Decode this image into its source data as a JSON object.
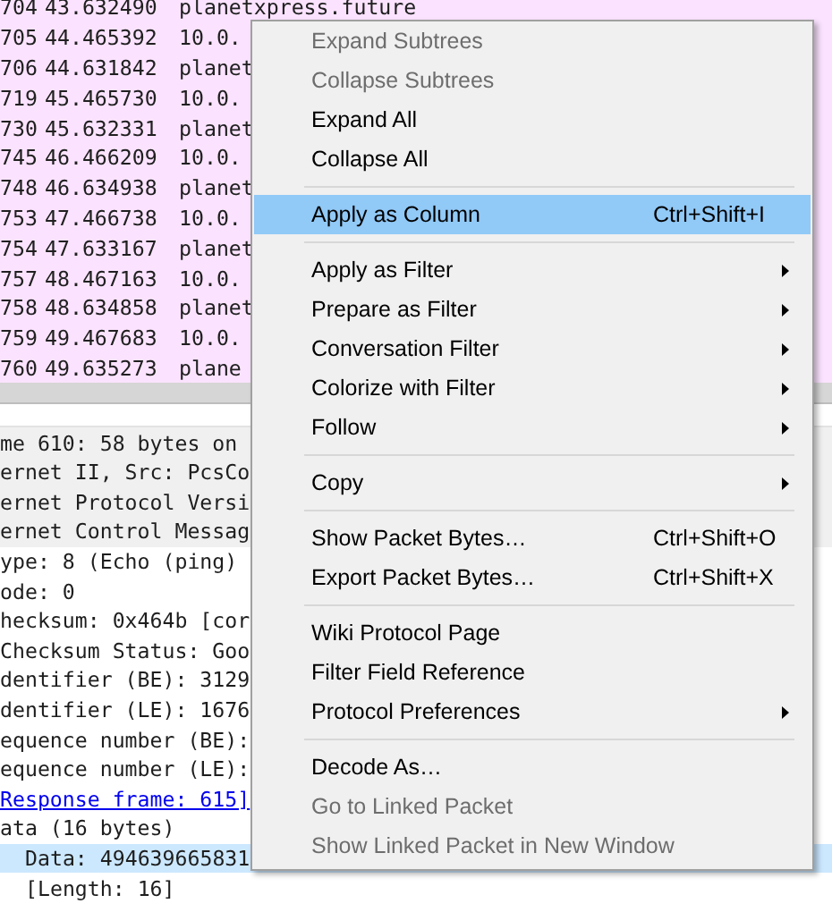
{
  "packet_list": {
    "rows": [
      {
        "number": "704",
        "time": "43.632490",
        "source": "planetxpress.future"
      },
      {
        "number": "705",
        "time": "44.465392",
        "source": "10.0."
      },
      {
        "number": "706",
        "time": "44.631842",
        "source": "planet"
      },
      {
        "number": "719",
        "time": "45.465730",
        "source": "10.0."
      },
      {
        "number": "730",
        "time": "45.632331",
        "source": "planet"
      },
      {
        "number": "745",
        "time": "46.466209",
        "source": "10.0."
      },
      {
        "number": "748",
        "time": "46.634938",
        "source": "planet"
      },
      {
        "number": "753",
        "time": "47.466738",
        "source": "10.0."
      },
      {
        "number": "754",
        "time": "47.633167",
        "source": "planet"
      },
      {
        "number": "757",
        "time": "48.467163",
        "source": "10.0."
      },
      {
        "number": "758",
        "time": "48.634858",
        "source": "planet"
      },
      {
        "number": "759",
        "time": "49.467683",
        "source": "10.0."
      },
      {
        "number": "760",
        "time": "49.635273",
        "source": "plane"
      }
    ]
  },
  "packet_details": {
    "rows": [
      {
        "kind": "header",
        "text": "me 610: 58 bytes on",
        "selected": false
      },
      {
        "kind": "header",
        "text": "ernet II, Src: PcsCo",
        "selected": false
      },
      {
        "kind": "header",
        "text": "ernet Protocol Versi",
        "selected": false
      },
      {
        "kind": "header",
        "text": "ernet Control Messag",
        "selected": false
      },
      {
        "kind": "field",
        "text": "ype: 8 (Echo (ping)",
        "selected": false
      },
      {
        "kind": "field",
        "text": "ode: 0",
        "selected": false
      },
      {
        "kind": "field",
        "text": "hecksum: 0x464b [cor",
        "selected": false
      },
      {
        "kind": "field",
        "text": "Checksum Status: Goo",
        "selected": false
      },
      {
        "kind": "field",
        "text": "dentifier (BE): 3129",
        "selected": false
      },
      {
        "kind": "field",
        "text": "dentifier (LE): 1676",
        "selected": false
      },
      {
        "kind": "field",
        "text": "equence number (BE):",
        "selected": false
      },
      {
        "kind": "field",
        "text": "equence number (LE):",
        "selected": false
      },
      {
        "kind": "link",
        "text": "Response frame: 615]",
        "selected": false
      },
      {
        "kind": "field",
        "text": "ata (16 bytes)",
        "selected": false
      },
      {
        "kind": "child",
        "text": "Data: 494639665831",
        "selected": true
      },
      {
        "kind": "child",
        "text": "[Length: 16]",
        "selected": false
      }
    ]
  },
  "context_menu": {
    "items": [
      {
        "kind": "item",
        "label": "Expand Subtrees",
        "disabled": true,
        "selected": false,
        "submenu": false
      },
      {
        "kind": "item",
        "label": "Collapse Subtrees",
        "disabled": true,
        "selected": false,
        "submenu": false
      },
      {
        "kind": "item",
        "label": "Expand All",
        "disabled": false,
        "selected": false,
        "submenu": false
      },
      {
        "kind": "item",
        "label": "Collapse All",
        "disabled": false,
        "selected": false,
        "submenu": false
      },
      {
        "kind": "separator"
      },
      {
        "kind": "item",
        "label": "Apply as Column",
        "shortcut": "Ctrl+Shift+I",
        "disabled": false,
        "selected": true,
        "submenu": false
      },
      {
        "kind": "separator"
      },
      {
        "kind": "item",
        "label": "Apply as Filter",
        "disabled": false,
        "selected": false,
        "submenu": true
      },
      {
        "kind": "item",
        "label": "Prepare as Filter",
        "disabled": false,
        "selected": false,
        "submenu": true
      },
      {
        "kind": "item",
        "label": "Conversation Filter",
        "disabled": false,
        "selected": false,
        "submenu": true
      },
      {
        "kind": "item",
        "label": "Colorize with Filter",
        "disabled": false,
        "selected": false,
        "submenu": true
      },
      {
        "kind": "item",
        "label": "Follow",
        "disabled": false,
        "selected": false,
        "submenu": true
      },
      {
        "kind": "separator"
      },
      {
        "kind": "item",
        "label": "Copy",
        "disabled": false,
        "selected": false,
        "submenu": true
      },
      {
        "kind": "separator"
      },
      {
        "kind": "item",
        "label": "Show Packet Bytes…",
        "shortcut": "Ctrl+Shift+O",
        "disabled": false,
        "selected": false,
        "submenu": false
      },
      {
        "kind": "item",
        "label": "Export Packet Bytes…",
        "shortcut": "Ctrl+Shift+X",
        "disabled": false,
        "selected": false,
        "submenu": false
      },
      {
        "kind": "separator"
      },
      {
        "kind": "item",
        "label": "Wiki Protocol Page",
        "disabled": false,
        "selected": false,
        "submenu": false
      },
      {
        "kind": "item",
        "label": "Filter Field Reference",
        "disabled": false,
        "selected": false,
        "submenu": false
      },
      {
        "kind": "item",
        "label": "Protocol Preferences",
        "disabled": false,
        "selected": false,
        "submenu": true
      },
      {
        "kind": "separator"
      },
      {
        "kind": "item",
        "label": "Decode As…",
        "disabled": false,
        "selected": false,
        "submenu": false
      },
      {
        "kind": "item",
        "label": "Go to Linked Packet",
        "disabled": true,
        "selected": false,
        "submenu": false
      },
      {
        "kind": "item",
        "label": "Show Linked Packet in New Window",
        "disabled": true,
        "selected": false,
        "submenu": false
      }
    ]
  }
}
